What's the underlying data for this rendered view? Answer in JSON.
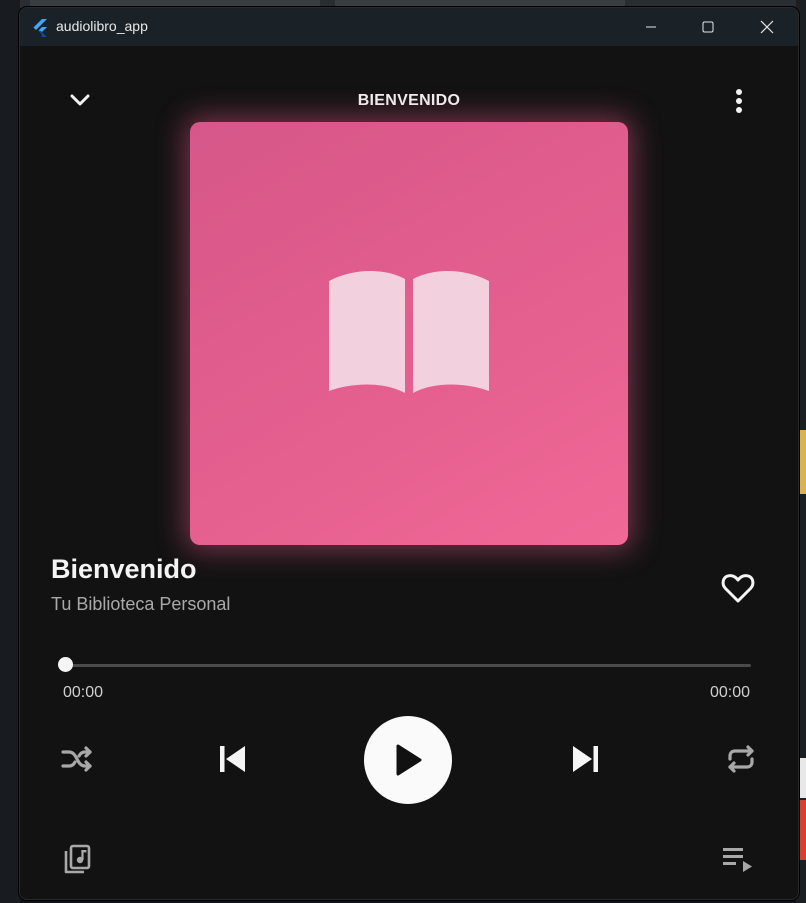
{
  "window": {
    "title": "audiolibro_app",
    "icons": {
      "app": "flutter-logo-icon",
      "minimize": "minimize-icon",
      "maximize": "maximize-icon",
      "close": "close-icon"
    }
  },
  "header": {
    "title": "BIENVENIDO",
    "left_icon": "chevron-down-icon",
    "right_icon": "more-vertical-icon"
  },
  "artwork": {
    "icon": "open-book-icon",
    "colors": {
      "start": "#d65789",
      "end": "#f06896",
      "glow": "#e8568a"
    }
  },
  "track": {
    "title": "Bienvenido",
    "subtitle": "Tu Biblioteca Personal",
    "favorite_icon": "heart-outline-icon"
  },
  "progress": {
    "elapsed": "00:00",
    "total": "00:00",
    "fraction": 0
  },
  "controls": {
    "shuffle": "shuffle-icon",
    "previous": "skip-previous-icon",
    "play": "play-icon",
    "next": "skip-next-icon",
    "repeat": "repeat-icon"
  },
  "bottom_bar": {
    "left_icon": "library-music-icon",
    "right_icon": "queue-play-icon"
  },
  "colors": {
    "background": "#121212",
    "titlebar": "#1a2228",
    "text_primary": "#f4f4f4",
    "text_secondary": "#a9a9a9",
    "accent": "#e45f8e"
  }
}
